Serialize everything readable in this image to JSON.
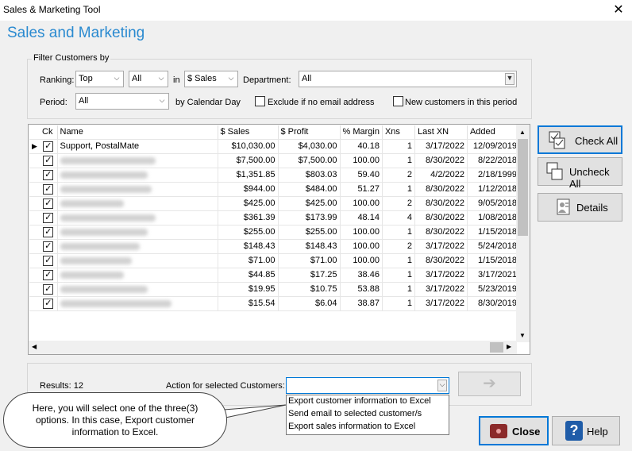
{
  "window": {
    "title": "Sales & Marketing Tool",
    "close_glyph": "✕"
  },
  "heading": "Sales and Marketing",
  "filter": {
    "legend": "Filter Customers by",
    "ranking_label": "Ranking:",
    "ranking_value": "Top",
    "count_value": "All",
    "in_label": "in",
    "metric_value": "$ Sales",
    "department_label": "Department:",
    "department_value": "All",
    "period_label": "Period:",
    "period_value": "All",
    "by_calendar_day": "by Calendar Day",
    "exclude_no_email": "Exclude if no email address",
    "new_customers": "New customers in this period"
  },
  "grid": {
    "columns": [
      "Ck",
      "Name",
      "$ Sales",
      "$ Profit",
      "% Margin",
      "Xns",
      "Last XN",
      "Added"
    ],
    "rows": [
      {
        "name": "Support, PostalMate",
        "sales": "$10,030.00",
        "profit": "$4,030.00",
        "margin": "40.18",
        "xns": "1",
        "last": "3/17/2022",
        "added": "12/09/2019",
        "current": true
      },
      {
        "name": "",
        "sales": "$7,500.00",
        "profit": "$7,500.00",
        "margin": "100.00",
        "xns": "1",
        "last": "8/30/2022",
        "added": "8/22/2018"
      },
      {
        "name": "",
        "sales": "$1,351.85",
        "profit": "$803.03",
        "margin": "59.40",
        "xns": "2",
        "last": "4/2/2022",
        "added": "2/18/1999"
      },
      {
        "name": "",
        "sales": "$944.00",
        "profit": "$484.00",
        "margin": "51.27",
        "xns": "1",
        "last": "8/30/2022",
        "added": "1/12/2018"
      },
      {
        "name": "",
        "sales": "$425.00",
        "profit": "$425.00",
        "margin": "100.00",
        "xns": "2",
        "last": "8/30/2022",
        "added": "9/05/2018"
      },
      {
        "name": "",
        "sales": "$361.39",
        "profit": "$173.99",
        "margin": "48.14",
        "xns": "4",
        "last": "8/30/2022",
        "added": "1/08/2018"
      },
      {
        "name": "",
        "sales": "$255.00",
        "profit": "$255.00",
        "margin": "100.00",
        "xns": "1",
        "last": "8/30/2022",
        "added": "1/15/2018"
      },
      {
        "name": "",
        "sales": "$148.43",
        "profit": "$148.43",
        "margin": "100.00",
        "xns": "2",
        "last": "3/17/2022",
        "added": "5/24/2018"
      },
      {
        "name": "",
        "sales": "$71.00",
        "profit": "$71.00",
        "margin": "100.00",
        "xns": "1",
        "last": "8/30/2022",
        "added": "1/15/2018"
      },
      {
        "name": "",
        "sales": "$44.85",
        "profit": "$17.25",
        "margin": "38.46",
        "xns": "1",
        "last": "3/17/2022",
        "added": "3/17/2021"
      },
      {
        "name": "",
        "sales": "$19.95",
        "profit": "$10.75",
        "margin": "53.88",
        "xns": "1",
        "last": "3/17/2022",
        "added": "5/23/2019"
      },
      {
        "name": "",
        "sales": "$15.54",
        "profit": "$6.04",
        "margin": "38.87",
        "xns": "1",
        "last": "3/17/2022",
        "added": "8/30/2019"
      }
    ]
  },
  "side_buttons": {
    "check_all": "Check All",
    "uncheck_all": "Uncheck All",
    "details": "Details"
  },
  "bottom": {
    "results_label": "Results: 12",
    "action_label": "Action for selected Customers:",
    "action_value": "",
    "options": [
      "Export customer information to Excel",
      "Send email to selected customer/s",
      "Export sales information to Excel"
    ],
    "go_glyph": "➔"
  },
  "callout": "Here, you will select one of the three(3) options. In this case, Export customer information to Excel.",
  "footer": {
    "close": "Close",
    "help": "Help"
  },
  "colors": {
    "heading": "#2a8ad0",
    "accent_border": "#0078d7",
    "close_icon": "#8b2a2a",
    "help_icon": "#1f5ca8"
  }
}
